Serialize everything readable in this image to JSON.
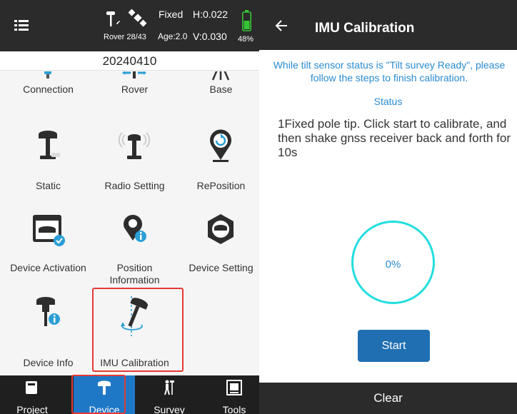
{
  "left": {
    "status": {
      "fix_state": "Fixed",
      "rover_label": "Rover 28/43",
      "age_label": "Age:2.0",
      "h_value": "H:0.022",
      "v_value": "V:0.030",
      "battery": "48%"
    },
    "project_name": "20240410",
    "tiles": [
      {
        "label": "Connection",
        "icon": "connection-icon"
      },
      {
        "label": "Rover",
        "icon": "rover-icon"
      },
      {
        "label": "Base",
        "icon": "base-icon"
      },
      {
        "label": "Static",
        "icon": "static-receiver-icon"
      },
      {
        "label": "Radio Setting",
        "icon": "radio-receiver-icon"
      },
      {
        "label": "RePosition",
        "icon": "reposition-icon"
      },
      {
        "label": "Device Activation",
        "icon": "device-activation-icon"
      },
      {
        "label": "Position Information",
        "icon": "position-info-icon"
      },
      {
        "label": "Device Setting",
        "icon": "device-setting-icon"
      },
      {
        "label": "Device Info",
        "icon": "device-info-icon"
      },
      {
        "label": "IMU Calibration",
        "icon": "imu-calibration-icon"
      }
    ],
    "nav": [
      {
        "label": "Project",
        "icon": "project-icon"
      },
      {
        "label": "Device",
        "icon": "device-icon",
        "active": true
      },
      {
        "label": "Survey",
        "icon": "survey-icon"
      },
      {
        "label": "Tools",
        "icon": "tools-icon"
      }
    ]
  },
  "right": {
    "title": "IMU Calibration",
    "instruction": "While tilt sensor status is \"Tilt survey Ready\", please follow the steps to finish calibration.",
    "status_label": "Status",
    "step_text": "1Fixed pole tip. Click start to calibrate, and then shake gnss receiver back and forth for 10s",
    "progress": "0%",
    "start_label": "Start",
    "clear_label": "Clear"
  },
  "colors": {
    "accent_blue": "#1f78c6",
    "text_blue": "#2a8bd0",
    "ring_cyan": "#23dede",
    "highlight_red": "#e53935",
    "battery_green": "#35c435"
  }
}
